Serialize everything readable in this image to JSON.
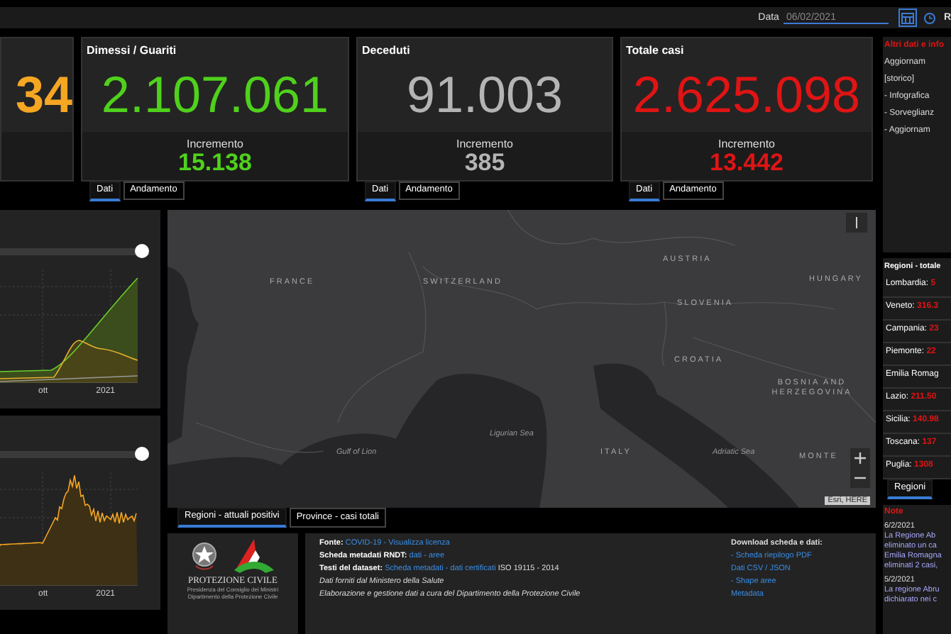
{
  "top_bar": {
    "date_label": "Data",
    "date_value": "06/02/2021",
    "cut_label": "R"
  },
  "kpi_cards": [
    {
      "value": "34",
      "color": "#f5a623"
    },
    {
      "title": "Dimessi / Guariti",
      "value": "2.107.061",
      "increment_label": "Incremento",
      "increment": "15.138",
      "color": "#4fd11c",
      "tabs": [
        {
          "label": "Dati",
          "selected": true
        },
        {
          "label": "Andamento",
          "selected": false
        }
      ]
    },
    {
      "title": "Deceduti",
      "value": "91.003",
      "increment_label": "Incremento",
      "increment": "385",
      "color": "#b4b4b4",
      "tabs": [
        {
          "label": "Dati",
          "selected": true
        },
        {
          "label": "Andamento",
          "selected": false
        }
      ]
    },
    {
      "title": "Totale casi",
      "value": "2.625.098",
      "increment_label": "Incremento",
      "increment": "13.442",
      "color": "#e01414",
      "tabs": [
        {
          "label": "Dati",
          "selected": true
        },
        {
          "label": "Andamento",
          "selected": false
        }
      ]
    }
  ],
  "charts": [
    {
      "kind": "trend",
      "level": 1,
      "x_labels": [
        "ott",
        "2021"
      ]
    },
    {
      "kind": "daily",
      "level": 1,
      "x_labels": [
        "ott",
        "2021"
      ]
    }
  ],
  "map": {
    "labels": [
      {
        "text": "FRANCE",
        "kind": "country"
      },
      {
        "text": "SWITZERLAND",
        "kind": "country"
      },
      {
        "text": "AUSTRIA",
        "kind": "country"
      },
      {
        "text": "HUNGARY",
        "kind": "country"
      },
      {
        "text": "SLOVENIA",
        "kind": "country"
      },
      {
        "text": "CROATIA",
        "kind": "country"
      },
      {
        "text": "BOSNIA AND HERZEGOVINA",
        "kind": "country"
      },
      {
        "text": "ITALY",
        "kind": "country"
      },
      {
        "text": "MONTE",
        "kind": "country"
      },
      {
        "text": "Gulf of Lion",
        "kind": "sea"
      },
      {
        "text": "Ligurian Sea",
        "kind": "sea"
      },
      {
        "text": "Adriatic Sea",
        "kind": "sea"
      }
    ],
    "attribution": "Esri, HERE",
    "tabs": [
      {
        "label": "Regioni - attuali positivi",
        "selected": true
      },
      {
        "label": "Province - casi totali",
        "selected": false
      }
    ]
  },
  "footer": {
    "org_name": "PROTEZIONE CIVILE",
    "org_lines": [
      "Presidenza del Consiglio dei Ministri",
      "Dipartimento della Protezione Civile"
    ],
    "lines": [
      {
        "label": "Fonte:",
        "link": "COVID-19 - Visualizza licenza"
      },
      {
        "label": "Scheda metadati RNDT:",
        "link": "dati - aree"
      },
      {
        "label": "Testi del dataset:",
        "link": "Scheda metadati - dati certificati",
        "suffix": "ISO 19115 - 2014"
      },
      {
        "label": "Dati forniti dal Ministero della Salute"
      },
      {
        "label": "Elaborazione e gestione dati a cura del Dipartimento della Protezione Civile"
      }
    ],
    "download_title": "Download scheda e dati:",
    "download_links": [
      "- Scheda riepilogo PDF",
      "Dati CSV / JSON",
      "- Shape aree",
      "Metadata"
    ]
  },
  "info_panel": {
    "title": "Altri dati e info",
    "items": [
      "Aggiornam",
      "[storico]",
      "- Infografica",
      "- Sorveglianz",
      "- Aggiornam"
    ]
  },
  "regions_panel": {
    "title": "Regioni - totale",
    "rows": [
      {
        "name": "Lombardia:",
        "value": "5"
      },
      {
        "name": "Veneto:",
        "value": "316.3"
      },
      {
        "name": "Campania:",
        "value": "23"
      },
      {
        "name": "Piemonte:",
        "value": "22"
      },
      {
        "name": "Emilia Romag"
      },
      {
        "name": "Lazio:",
        "value": "211.50"
      },
      {
        "name": "Sicilia:",
        "value": "140.98"
      },
      {
        "name": "Toscana:",
        "value": "137"
      },
      {
        "name": "Puglia:",
        "value": "1308"
      }
    ],
    "tabs": [
      {
        "label": "Regioni",
        "selected": true
      }
    ]
  },
  "notes": {
    "title": "Note",
    "entries": [
      {
        "date": "6/2/2021",
        "lines": [
          "La Regione Ab",
          "eliminato un ca",
          "Emilia Romagna",
          "eliminati 2 casi,"
        ]
      },
      {
        "date": "5/2/2021",
        "lines": [
          "La regione Abru",
          "dichiarato nei c"
        ]
      }
    ]
  }
}
